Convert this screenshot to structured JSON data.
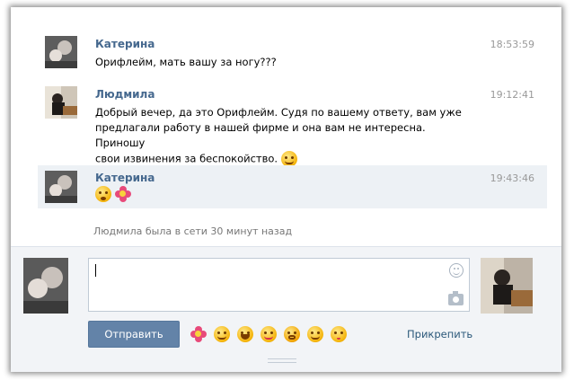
{
  "messages": [
    {
      "sender": "Катерина",
      "time": "18:53:59",
      "text": "Орифлейм, мать вашу за ногу???",
      "avatar": "katerina-avatar"
    },
    {
      "sender": "Людмила",
      "time": "19:12:41",
      "line1": "Добрый вечер, да это Орифлейм. Судя по вашему ответу, вам уже",
      "line2": "предлагали работу в нашей фирме и она вам не интересна. Приношу",
      "line3": "свои извинения за беспокойство.",
      "avatar": "ludmila-avatar"
    },
    {
      "sender": "Катерина",
      "time": "19:43:46",
      "emojis": [
        "surprised-emoji",
        "flower-emoji"
      ],
      "avatar": "katerina-avatar"
    }
  ],
  "status_text": "Людмила была в сети 30 минут назад",
  "composer": {
    "input_value": "",
    "send_label": "Отправить",
    "attach_label": "Прикрепить",
    "emoji_bar": [
      "flower-emoji",
      "grin-emoji",
      "laughing-emoji",
      "tongue-emoji",
      "scared-emoji",
      "wink-emoji",
      "kiss-emoji"
    ]
  },
  "colors": {
    "sender_name": "#45688e",
    "highlight_bg": "#edf1f5",
    "send_button": "#6383a8",
    "link": "#2b587a"
  }
}
